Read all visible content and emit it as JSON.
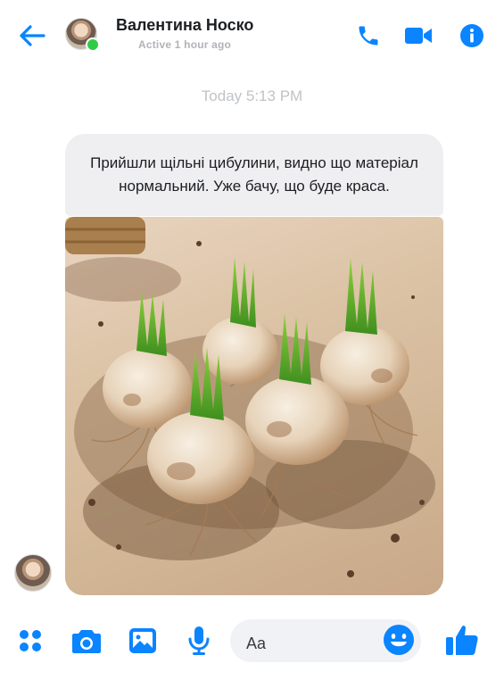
{
  "header": {
    "contact_name": "Валентина Носко",
    "status": "Active 1 hour ago",
    "icons": [
      "back-arrow-icon",
      "phone-icon",
      "video-camera-icon",
      "info-icon"
    ]
  },
  "conversation": {
    "timestamp": "Today 5:13 PM",
    "message_text": "Прийшли щільні цибулини, видно що матеріал нормальний. Уже бачу, що буде краса.",
    "photo_subject": "hyacinth-bulbs-photo"
  },
  "composer": {
    "placeholder": "Aa",
    "icons": [
      "apps-grid-icon",
      "camera-icon",
      "gallery-icon",
      "microphone-icon",
      "emoji-icon",
      "thumbs-up-icon"
    ]
  },
  "colors": {
    "accent": "#0a84ff",
    "online": "#31cc46",
    "bubble": "#efeff1",
    "muted_text": "#b0b3b8"
  }
}
